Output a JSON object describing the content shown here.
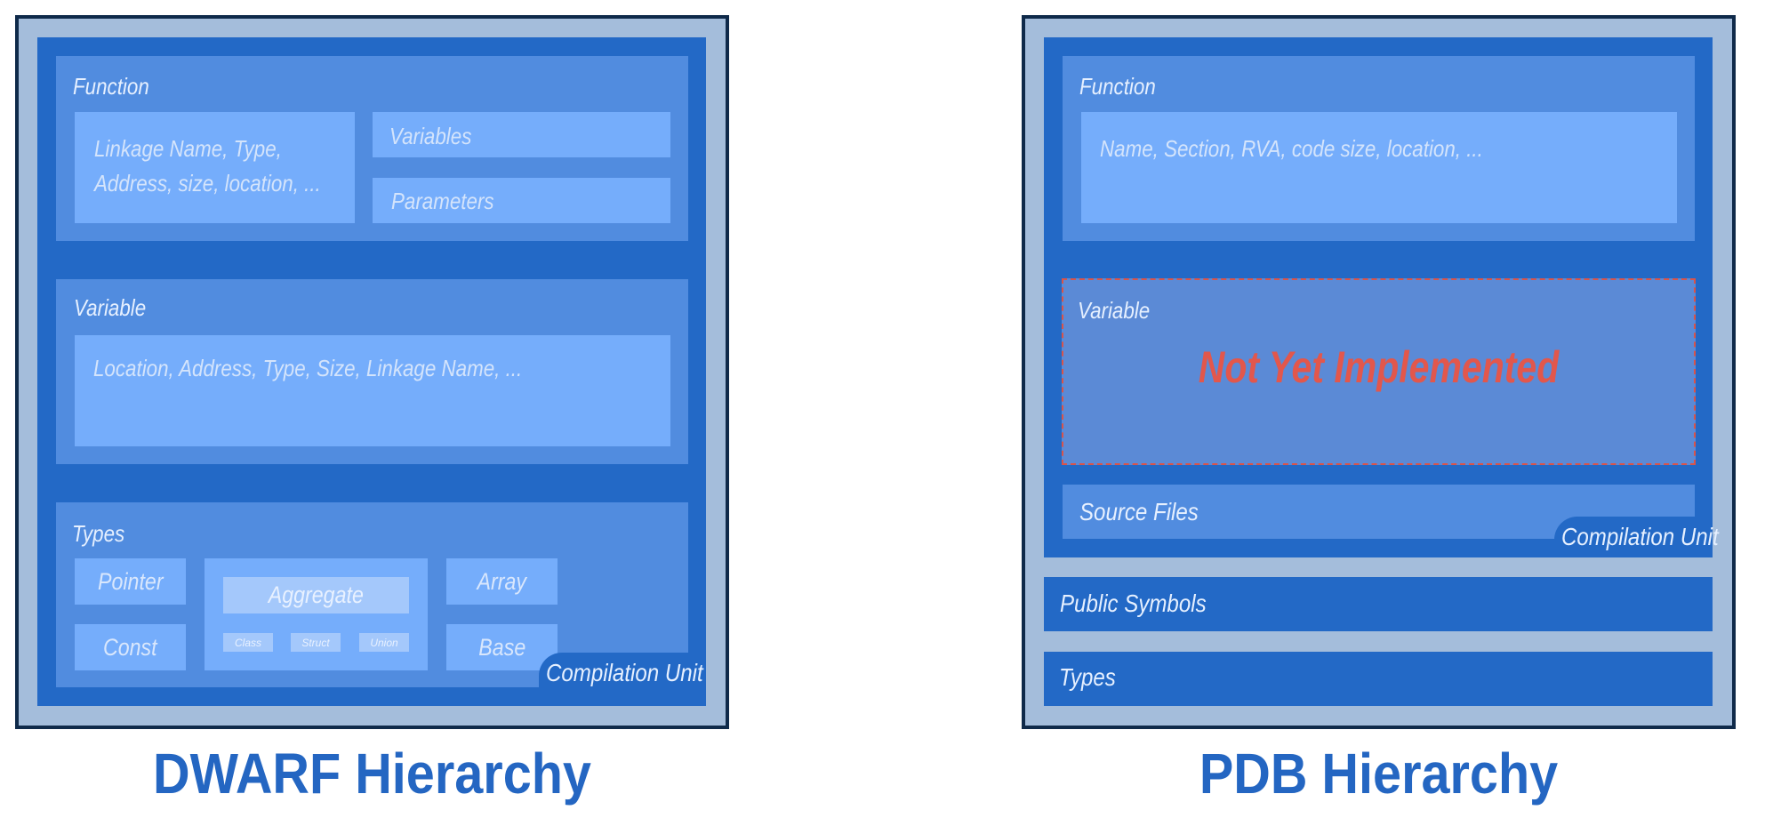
{
  "dwarf": {
    "title": "DWARF Hierarchy",
    "function": {
      "label": "Function",
      "attrs_line1": "Linkage Name, Type,",
      "attrs_line2": "Address, size, location, ...",
      "variables": "Variables",
      "parameters": "Parameters"
    },
    "variable": {
      "label": "Variable",
      "attrs": "Location, Address, Type, Size, Linkage Name, ..."
    },
    "types": {
      "label": "Types",
      "pointer": "Pointer",
      "const": "Const",
      "aggregate": "Aggregate",
      "class": "Class",
      "struct": "Struct",
      "union": "Union",
      "array": "Array",
      "base": "Base"
    },
    "compilation_unit": "Compilation Unit"
  },
  "pdb": {
    "title": "PDB Hierarchy",
    "function": {
      "label": "Function",
      "attrs": "Name, Section, RVA, code size, location, ..."
    },
    "variable": {
      "label": "Variable",
      "status": "Not Yet Implemented"
    },
    "source_files": "Source Files",
    "compilation_unit": "Compilation Unit",
    "public_symbols": "Public Symbols",
    "types": "Types"
  },
  "colors": {
    "outer_frame": "#a4bddb",
    "frame_border": "#0f2a4a",
    "compilation_unit": "#2369c6",
    "section": "#518cdf",
    "leaf": "#75adfb",
    "not_implemented": "#e2574c",
    "title": "#2466c2"
  }
}
